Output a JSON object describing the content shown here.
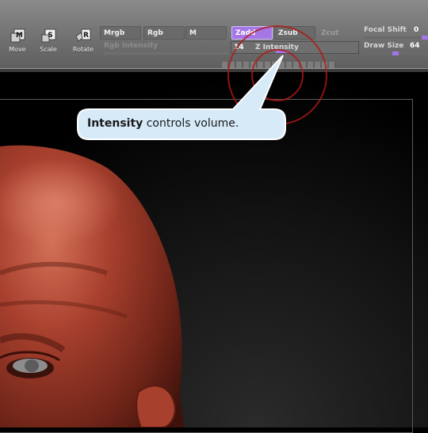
{
  "toolbar": {
    "tools": [
      {
        "letter": "M",
        "label": "Move"
      },
      {
        "letter": "S",
        "label": "Scale"
      },
      {
        "letter": "R",
        "label": "Rotate"
      }
    ],
    "modes": {
      "mrgb": "Mrgb",
      "rgb": "Rgb",
      "m": "M",
      "zadd": "Zadd",
      "zsub": "Zsub",
      "zcut": "Zcut"
    },
    "rgb_intensity_label": "Rgb Intensity",
    "z_intensity": {
      "value": "14",
      "label": "Z Intensity",
      "level": 0.14
    },
    "focal_shift": {
      "label": "Focal Shift",
      "value": "0"
    },
    "draw_size": {
      "label": "Draw Size",
      "value": "64"
    }
  },
  "tooltip": {
    "bold": "Intensity",
    "rest": " controls volume."
  },
  "colors": {
    "accent": "#a476e6",
    "skin": "#a8402e",
    "cursor": "#b01818"
  }
}
